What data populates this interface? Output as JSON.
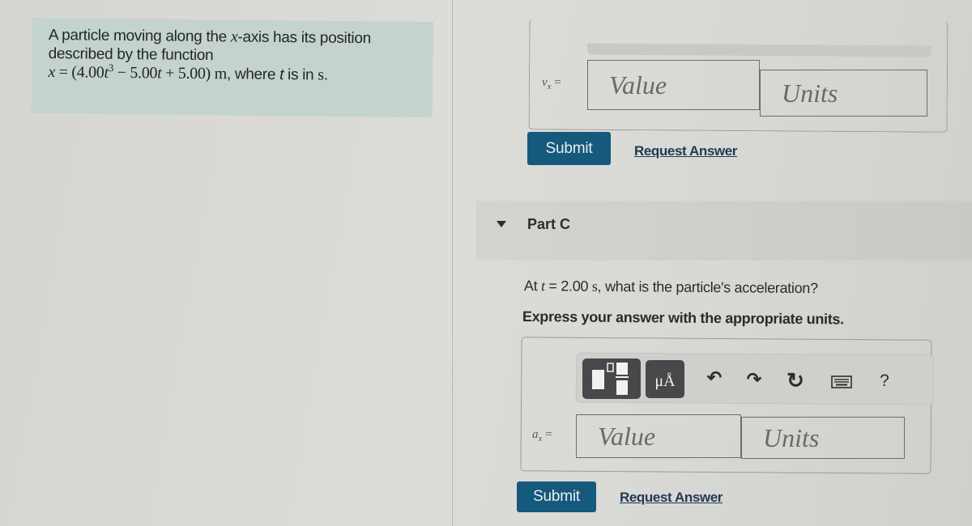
{
  "intro": {
    "line1_pre": "A particle moving along the ",
    "line1_var": "x",
    "line1_post": "-axis has its position",
    "line2": "described by the function",
    "eq_lhs": "x",
    "eq_eq": " = (4.00",
    "eq_t1": "t",
    "eq_exp": "3",
    "eq_mid": " − 5.00",
    "eq_t2": "t",
    "eq_end": " + 5.00) ",
    "eq_unit": "m",
    "eq_tail_pre": ", where ",
    "eq_tail_var": "t",
    "eq_tail_mid": " is in ",
    "eq_tail_unit": "s",
    "eq_tail_end": "."
  },
  "part_b": {
    "var_symbol": "v",
    "var_sub": "x",
    "equals": " =",
    "value_placeholder": "Value",
    "units_placeholder": "Units",
    "submit_label": "Submit",
    "request_label": "Request Answer"
  },
  "part_c": {
    "title": "Part C",
    "question_pre": "At ",
    "question_var": "t",
    "question_mid": " = 2.00 ",
    "question_unit": "s",
    "question_post": ", what is the particle's acceleration?",
    "instruction": "Express your answer with the appropriate units.",
    "toolbar": {
      "templates_icon": "fraction-template-icon",
      "units_label": "μÅ",
      "undo_icon": "↶",
      "redo_icon": "↷",
      "reset_icon": "↻",
      "keyboard_icon": "keyboard-icon",
      "help_label": "?"
    },
    "var_symbol": "a",
    "var_sub": "x",
    "equals": " =",
    "value_placeholder": "Value",
    "units_placeholder": "Units",
    "submit_label": "Submit",
    "request_label": "Request Answer"
  },
  "colors": {
    "submit_bg": "#15597c",
    "intro_bg": "#c4d3cd",
    "link": "#233a52"
  }
}
